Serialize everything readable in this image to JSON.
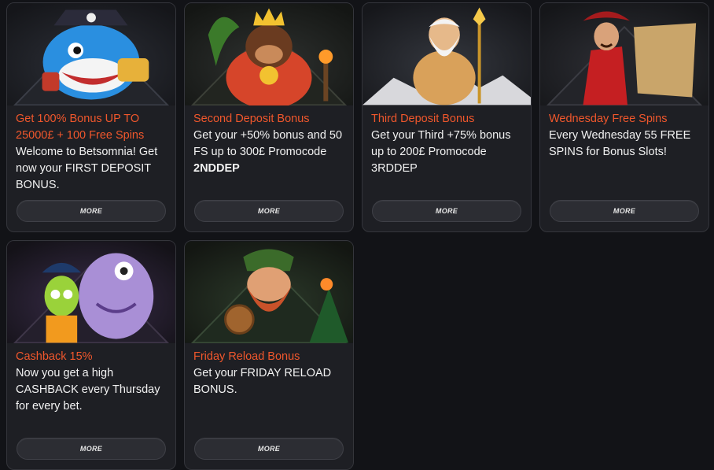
{
  "promotions": [
    {
      "title": "Get 100% Bonus UP TO 25000£ + 100 Free Spins",
      "description": "Welcome to Betsomnia! Get now your FIRST DEPOSIT BONUS.",
      "button": "MORE",
      "art_icon": "pirate-shark-character"
    },
    {
      "title": "Second Deposit Bonus",
      "description_pre": "Get your +50% bonus and 50 FS up to 300£ Promocode ",
      "promocode": "2NDDEP",
      "button": "MORE",
      "art_icon": "gorilla-king-character"
    },
    {
      "title": "Third Deposit Bonus",
      "description": "Get your  Third +75% bonus up to 200£ Promocode 3RDDEP",
      "button": "MORE",
      "art_icon": "zeus-character"
    },
    {
      "title": "Wednesday Free Spins",
      "description": "Every Wednesday 55 FREE SPINS for Bonus Slots!",
      "button": "MORE",
      "art_icon": "pirate-captain-character"
    },
    {
      "title": "Cashback 15%",
      "description": "Now you get a high CASHBACK every Thursday for every bet.",
      "button": "MORE",
      "art_icon": "monster-and-alien-characters"
    },
    {
      "title": "Friday Reload Bonus",
      "description": "Get your FRIDAY RELOAD BONUS.",
      "button": "MORE",
      "art_icon": "dwarf-warrior-character"
    }
  ],
  "colors": {
    "background": "#121317",
    "card": "#1e1f24",
    "title_accent": "#f0572c",
    "text": "#f2f2f2"
  }
}
